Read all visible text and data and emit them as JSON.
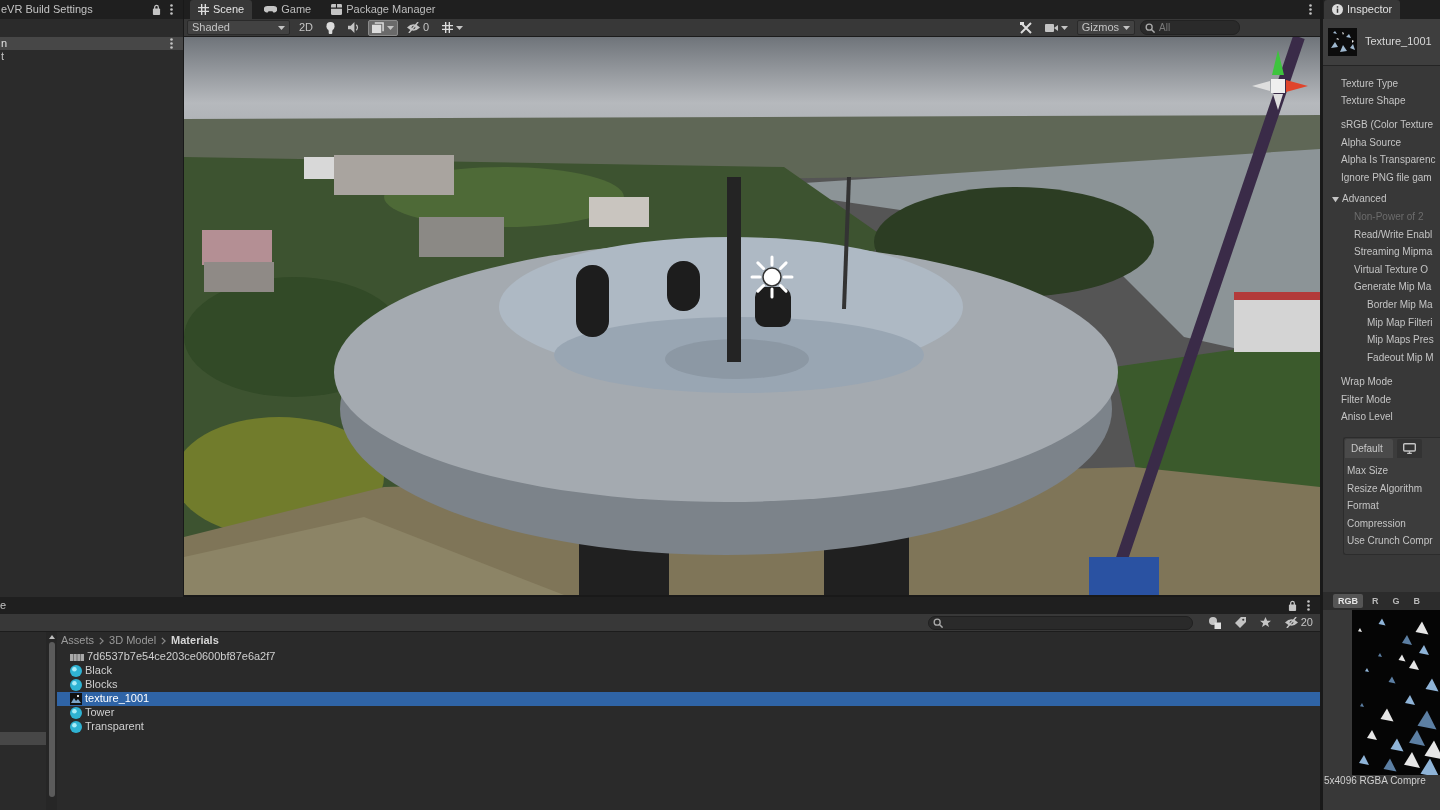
{
  "hierarchy": {
    "title": "eVR Build Settings",
    "items": [
      {
        "label": "n",
        "selected": true
      },
      {
        "label": "t",
        "selected": false
      }
    ]
  },
  "scene_view": {
    "tabs": [
      {
        "label": "Scene",
        "kind": "scene",
        "selected": true
      },
      {
        "label": "Game",
        "kind": "game",
        "selected": false
      },
      {
        "label": "Package Manager",
        "kind": "package",
        "selected": false
      }
    ],
    "toolbar": {
      "shading": "Shaded",
      "mode_2d": "2D",
      "toggles": [
        {
          "kind": "lighting",
          "on": false
        },
        {
          "kind": "audio",
          "on": false
        },
        {
          "kind": "effects",
          "on": true
        },
        {
          "kind": "visibility",
          "on": false,
          "count": "0"
        },
        {
          "kind": "grid",
          "on": false
        }
      ],
      "gizmos": "Gizmos",
      "search": {
        "placeholder": "All"
      }
    }
  },
  "inspector": {
    "tab": "Inspector",
    "asset_name": "Texture_1001",
    "groups": [
      {
        "rows": [
          "Texture Type",
          "Texture Shape"
        ]
      },
      {
        "rows": [
          "sRGB (Color Texture",
          "Alpha Source",
          "Alpha Is Transparenc",
          "Ignore PNG file gam"
        ]
      }
    ],
    "advanced": {
      "label": "Advanced",
      "expanded": true,
      "children": [
        {
          "label": "Non-Power of 2",
          "disabled": true
        },
        {
          "label": "Read/Write Enabl",
          "disabled": false
        },
        {
          "label": "Streaming Mipma",
          "disabled": false
        },
        {
          "label": "Virtual Texture O",
          "disabled": false
        },
        {
          "label": "Generate Mip Ma",
          "disabled": false,
          "children": [
            {
              "label": "Border Mip Ma",
              "disabled": false
            },
            {
              "label": "Mip Map Filteri",
              "disabled": false
            },
            {
              "label": "Mip Maps Pres",
              "disabled": false
            },
            {
              "label": "Fadeout Mip M",
              "disabled": false
            }
          ]
        }
      ]
    },
    "sampling": [
      "Wrap Mode",
      "Filter Mode",
      "Aniso Level"
    ],
    "platform": {
      "tabs": [
        {
          "kind": "text",
          "label": "Default",
          "selected": true
        },
        {
          "kind": "monitor",
          "selected": false
        }
      ],
      "settings": [
        "Max Size",
        "Resize Algorithm",
        "Format",
        "Compression",
        "Use Crunch Compr"
      ]
    },
    "preview": {
      "channels": [
        {
          "label": "RGB",
          "selected": true
        },
        {
          "label": "R",
          "selected": false
        },
        {
          "label": "G",
          "selected": false
        },
        {
          "label": "B",
          "selected": false
        }
      ],
      "info": "5x4096 RGBA Compre"
    }
  },
  "project": {
    "tab": "e",
    "hidden_count": "20",
    "breadcrumb": [
      "Assets",
      "3D Model",
      "Materials"
    ],
    "assets": [
      {
        "name": "7d6537b7e54ce203ce0600bf87e6a2f7",
        "kind": "model",
        "selected": false
      },
      {
        "name": "Black",
        "kind": "material",
        "selected": false
      },
      {
        "name": "Blocks",
        "kind": "material",
        "selected": false
      },
      {
        "name": "texture_1001",
        "kind": "texture",
        "selected": true
      },
      {
        "name": "Tower",
        "kind": "material",
        "selected": false
      },
      {
        "name": "Transparent",
        "kind": "material",
        "selected": false
      }
    ]
  }
}
